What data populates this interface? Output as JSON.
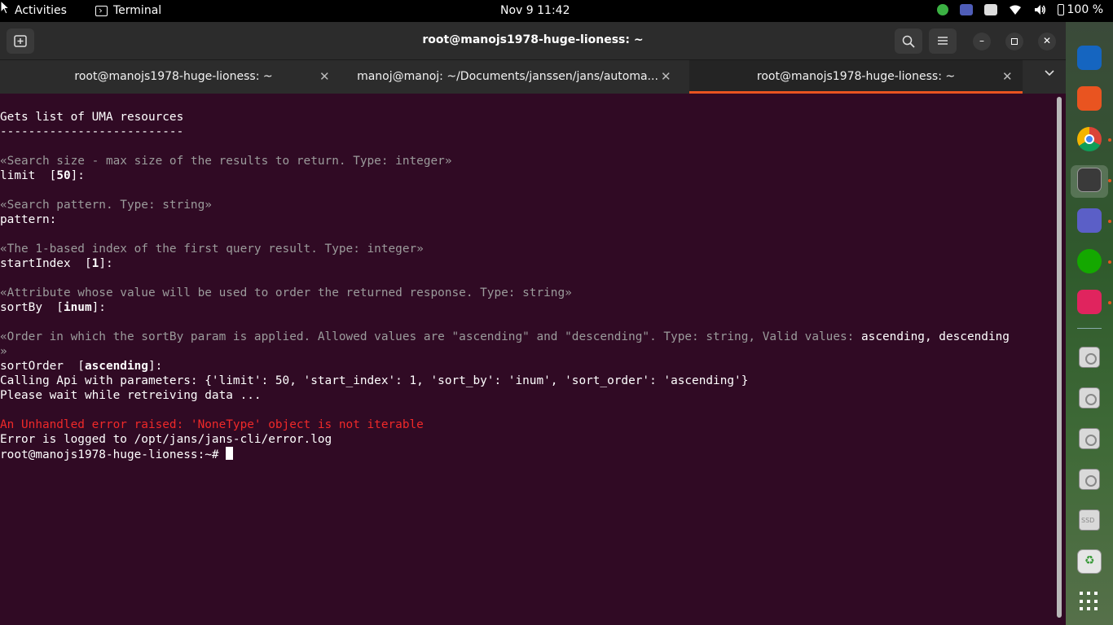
{
  "topbar": {
    "activities": "Activities",
    "app_name": "Terminal",
    "clock": "Nov 9  11:42",
    "battery": "100 %"
  },
  "window": {
    "title": "root@manojs1978-huge-lioness: ~",
    "tabs": [
      {
        "label": "root@manojs1978-huge-lioness: ~",
        "active": false
      },
      {
        "label": "manoj@manoj: ~/Documents/janssen/jans/automa...",
        "active": false
      },
      {
        "label": "root@manojs1978-huge-lioness: ~",
        "active": true
      }
    ]
  },
  "terminal": {
    "line1": "Gets list of UMA resources",
    "line2": "--------------------------",
    "limit_hint": "«Search size - max size of the results to return. Type: integer»",
    "limit_prompt_a": "limit  [",
    "limit_default": "50",
    "limit_prompt_b": "]:",
    "pattern_hint": "«Search pattern. Type: string»",
    "pattern_prompt": "pattern:",
    "start_hint": "«The 1-based index of the first query result. Type: integer»",
    "start_prompt_a": "startIndex  [",
    "start_default": "1",
    "start_prompt_b": "]:",
    "sortby_hint": "«Attribute whose value will be used to order the returned response. Type: string»",
    "sortby_prompt_a": "sortBy  [",
    "sortby_default": "inum",
    "sortby_prompt_b": "]:",
    "order_hint": "«Order in which the sortBy param is applied. Allowed values are \"ascending\" and \"descending\". Type: string, Valid values: ",
    "order_valid": "ascending, descending",
    "order_hint_end": "»",
    "order_prompt_a": "sortOrder  [",
    "order_default": "ascending",
    "order_prompt_b": "]:",
    "calling": "Calling Api with parameters: {'limit': 50, 'start_index': 1, 'sort_by': 'inum', 'sort_order': 'ascending'}",
    "waiting": "Please wait while retreiving data ...",
    "error": "An Unhandled error raised: 'NoneType' object is not iterable",
    "logged": "Error is logged to /opt/jans/jans-cli/error.log",
    "prompt": "root@manojs1978-huge-lioness:~# "
  },
  "dock": {
    "ssd_label": "SSD"
  },
  "colors": {
    "terminal_bg": "#300a24",
    "accent": "#e95420",
    "error": "#ef2929",
    "hint": "#9b9b9b"
  }
}
